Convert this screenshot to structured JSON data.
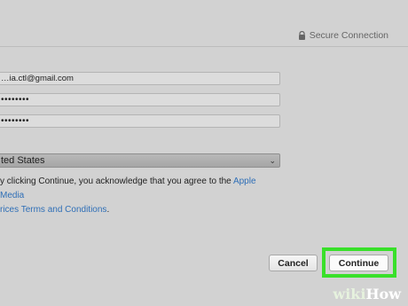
{
  "header": {
    "secure_label": "Secure Connection"
  },
  "form": {
    "email_value": "…ia.ctl@gmail.com",
    "password_value": "••••••••",
    "verify_value": "••••••••",
    "country_value": "ted States"
  },
  "legal": {
    "prefix": "y clicking Continue, you acknowledge that you agree to the ",
    "link1": "Apple Media",
    "link2": "rices Terms and Conditions",
    "suffix": "."
  },
  "actions": {
    "cancel_label": "Cancel",
    "continue_label": "Continue"
  },
  "watermark": {
    "wiki": "wiki",
    "how": "How"
  },
  "colors": {
    "highlight": "#39e02a",
    "link": "#2f6fb7",
    "background": "#d2d2d2"
  }
}
